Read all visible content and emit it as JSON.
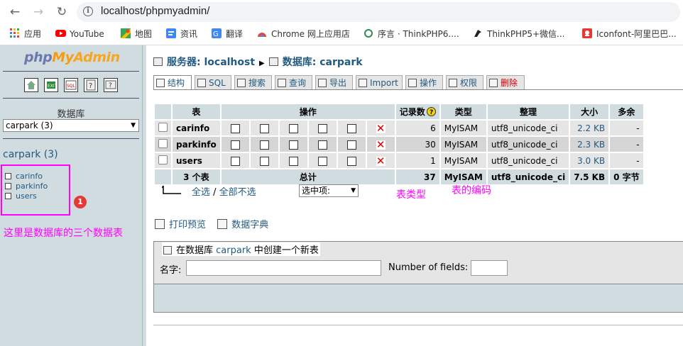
{
  "browser": {
    "url": "localhost/phpmyadmin/",
    "bookmarks": [
      {
        "label": "应用",
        "icon": "apps-grid-icon",
        "color": "#ea4335"
      },
      {
        "label": "YouTube",
        "icon": "youtube-icon",
        "color": "#ff0000"
      },
      {
        "label": "地图",
        "icon": "maps-icon",
        "color": "#34a853"
      },
      {
        "label": "资讯",
        "icon": "news-icon",
        "color": "#4285f4"
      },
      {
        "label": "翻译",
        "icon": "translate-icon",
        "color": "#4285f4"
      },
      {
        "label": "Chrome 网上应用店",
        "icon": "webstore-icon",
        "color": "#ea4335"
      },
      {
        "label": "序言 · ThinkPHP6....",
        "icon": "thinkphp-icon",
        "color": "#2e8b57"
      },
      {
        "label": "ThinkPHP5+微信...",
        "icon": "thinkphp5-icon",
        "color": "#222222"
      },
      {
        "label": "Iconfont-阿里巴巴...",
        "icon": "iconfont-icon",
        "color": "#e53935"
      }
    ]
  },
  "left": {
    "logo": {
      "part1": "php",
      "part2": "My",
      "part3": "Admin"
    },
    "database_label": "数据库",
    "database_select": "carpark (3)",
    "db_title": "carpark (3)",
    "tables": [
      "carinfo",
      "parkinfo",
      "users"
    ],
    "annotation_badge": "1",
    "annotation_text": "这里是数据库的三个数据表"
  },
  "breadcrumb": {
    "server": "服务器: localhost",
    "database": "数据库: carpark"
  },
  "tabs": [
    "结构",
    "SQL",
    "搜索",
    "查询",
    "导出",
    "Import",
    "操作",
    "权限",
    "删除"
  ],
  "table": {
    "headers": [
      "表",
      "操作",
      "记录数",
      "类型",
      "整理",
      "大小",
      "多余"
    ],
    "rows": [
      {
        "name": "carinfo",
        "records": "6",
        "type": "MyISAM",
        "collation": "utf8_unicode_ci",
        "size": "2.2 KB",
        "overhead": "-"
      },
      {
        "name": "parkinfo",
        "records": "30",
        "type": "MyISAM",
        "collation": "utf8_unicode_ci",
        "size": "2.3 KB",
        "overhead": "-"
      },
      {
        "name": "users",
        "records": "1",
        "type": "MyISAM",
        "collation": "utf8_unicode_ci",
        "size": "3.0 KB",
        "overhead": "-"
      }
    ],
    "footer": {
      "count": "3 个表",
      "label": "总计",
      "records": "37",
      "type": "MyISAM",
      "collation": "utf8_unicode_ci",
      "size": "7.5 KB",
      "overhead": "0 字节"
    }
  },
  "checkall": {
    "check_all": "全选",
    "separator": " / ",
    "uncheck_all": "全部不选",
    "with_selected": "选中项:"
  },
  "annotations": {
    "type": "表类型",
    "collation": "表的编码"
  },
  "links": {
    "print_view": "打印预览",
    "data_dictionary": "数据字典"
  },
  "create_table": {
    "legend_prefix": "在数据库",
    "db": "carpark",
    "legend_suffix": "中创建一个新表",
    "name_label": "名字:",
    "fields_label": "Number of fields:"
  }
}
